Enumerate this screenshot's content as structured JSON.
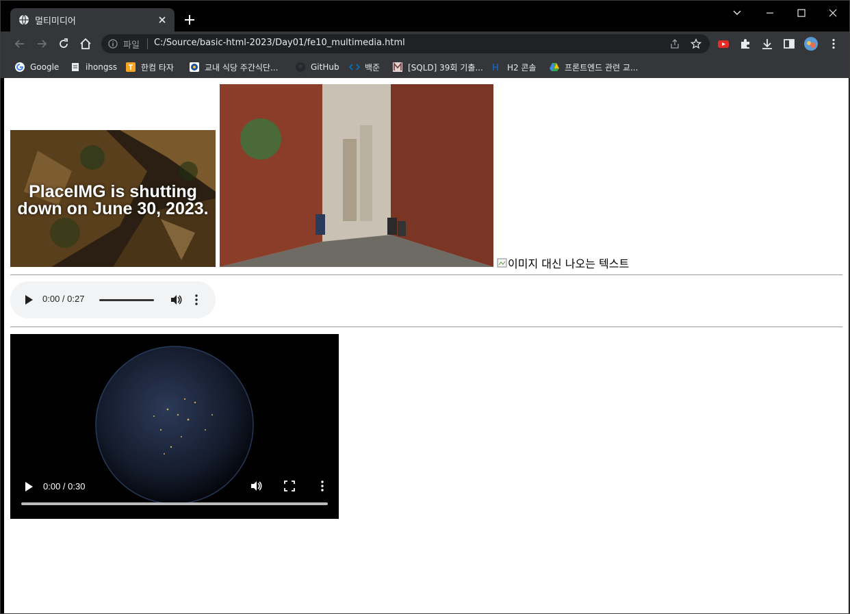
{
  "browser": {
    "tab_title": "멀티미디어",
    "omnibox": {
      "scheme_label": "파일",
      "url": "C:/Source/basic-html-2023/Day01/fe10_multimedia.html"
    },
    "bookmarks": [
      {
        "label": "Google",
        "icon": "google-icon",
        "color": "#4285f4"
      },
      {
        "label": "ihongss",
        "icon": "document-icon",
        "color": "#e8eaed"
      },
      {
        "label": "한컴 타자",
        "icon": "hancom-icon",
        "color": "#f4a623"
      },
      {
        "label": "교내 식당 주간식단...",
        "icon": "school-icon",
        "color": "#1a4fa0"
      },
      {
        "label": "GitHub",
        "icon": "github-icon",
        "color": "#24292e"
      },
      {
        "label": "백준",
        "icon": "code-icon",
        "color": "#0076c0"
      },
      {
        "label": "[SQLD] 39회 기출...",
        "icon": "m-icon",
        "color": "#c9a6a6"
      },
      {
        "label": "H2 콘솔",
        "icon": "h2-icon",
        "color": "#1565c0"
      },
      {
        "label": "프론트엔드 관련 교...",
        "icon": "drive-icon",
        "color": "#34a853"
      }
    ]
  },
  "page": {
    "placeimg_text": "PlaceIMG is shutting down on June 30, 2023.",
    "broken_image_alt": "이미지 대신 나오는 텍스트",
    "audio": {
      "time": "0:00 / 0:27"
    },
    "video": {
      "time": "0:00 / 0:30"
    }
  },
  "colors": {
    "chrome_dark": "#35363a",
    "tab_strip": "#000000",
    "omnibox": "#202124",
    "audio_bg": "#f1f3f4"
  }
}
